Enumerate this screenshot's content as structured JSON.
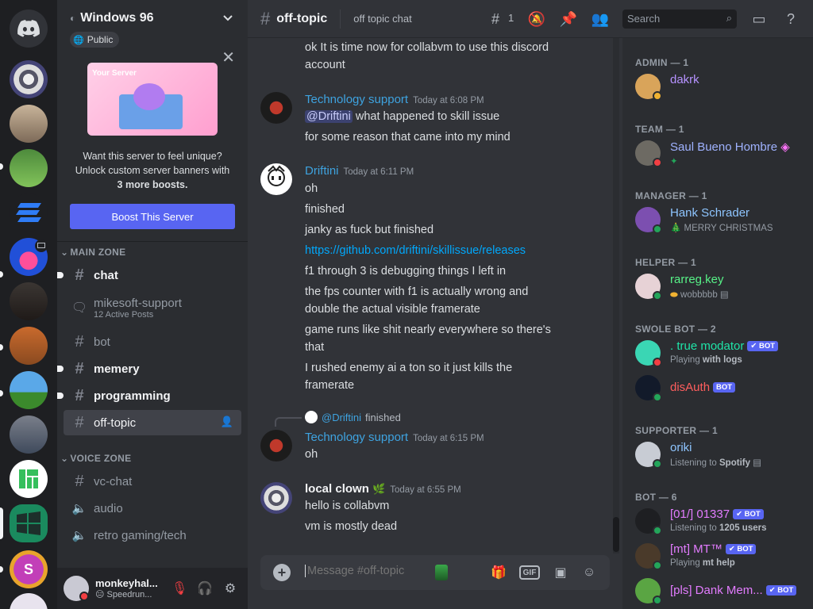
{
  "colors": {
    "accent": "#5865f2",
    "online": "#23a55a",
    "dnd": "#f23f43",
    "link": "#00a8fc"
  },
  "server": {
    "name": "Windows 96",
    "public_label": "Public"
  },
  "boost": {
    "card_title": "Your Server",
    "line1": "Want this server to feel unique?",
    "line2": "Unlock custom server banners with",
    "line3": "3 more boosts.",
    "button": "Boost This Server"
  },
  "categories": {
    "main": "MAIN ZONE",
    "voice": "VOICE ZONE"
  },
  "channels": {
    "chat": "chat",
    "mikesoft_support": "mikesoft-support",
    "mikesoft_sub": "12 Active Posts",
    "bot": "bot",
    "memery": "memery",
    "programming": "programming",
    "off_topic": "off-topic",
    "vc_chat": "vc-chat",
    "audio": "audio",
    "retro": "retro gaming/tech"
  },
  "user": {
    "name": "monkeyhal...",
    "status": "Speedrun..."
  },
  "topbar": {
    "channel": "off-topic",
    "topic": "off topic chat",
    "threads_count": "1",
    "search_placeholder": "Search"
  },
  "messages": {
    "m0_l1": "ok It is time now for collabvm to use this discord",
    "m0_l2": "account",
    "m1_author": "Technology support",
    "m1_time": "Today at 6:08 PM",
    "m1_mention": "@Driftini",
    "m1_l1": " what happened to skill issue",
    "m1_l2": "for some reason that came into my mind",
    "m2_author": "Driftini",
    "m2_time": "Today at 6:11 PM",
    "m2_l1": "oh",
    "m2_l2": "finished",
    "m2_l3": "janky as fuck but finished",
    "m2_link": "https://github.com/driftini/skillissue/releases",
    "m2_l4": "f1 through 3 is debugging things I left in",
    "m2_l5a": "the fps counter with f1 is actually wrong and",
    "m2_l5b": "double the actual visible framerate",
    "m2_l6a": "game runs like shit nearly everywhere so there's",
    "m2_l6b": "that",
    "m2_l7a": "I rushed enemy ai a ton so it just kills the",
    "m2_l7b": "framerate",
    "reply_name": "@Driftini",
    "reply_text": "finished",
    "m3_author": "Technology support",
    "m3_time": "Today at 6:15 PM",
    "m3_l1": "oh",
    "m4_author": "local clown",
    "m4_time": "Today at 6:55 PM",
    "m4_l1": "hello is collabvm",
    "m4_l2": "vm is mostly dead"
  },
  "composer": {
    "placeholder": "Message #off-topic",
    "gif": "GIF"
  },
  "members": {
    "admin": "ADMIN — 1",
    "dakrk": "dakrk",
    "team": "TEAM — 1",
    "saul": "Saul Bueno Hombre",
    "manager": "MANAGER — 1",
    "hank": "Hank Schrader",
    "hank_status": "🎄 MERRY CHRISTMAS",
    "helper": "HELPER — 1",
    "rarreg": "rarreg.key",
    "rarreg_status": "wobbbbb",
    "swole": "SWOLE BOT — 2",
    "truemod": ". true modator",
    "truemod_prefix": "Playing ",
    "truemod_bold": "with logs",
    "disauth": "disAuth",
    "supporter": "SUPPORTER — 1",
    "oriki": "oriki",
    "oriki_prefix": "Listening to ",
    "oriki_bold": "Spotify",
    "botrole": "BOT — 6",
    "b1": "[01/] 01337",
    "b1_prefix": "Listening to ",
    "b1_bold": "1205 users",
    "b2": "[mt] MT™",
    "b2_prefix": "Playing ",
    "b2_bold": "mt help",
    "b3": "[pls] Dank Mem...",
    "bot_badge": "BOT",
    "bot_badge_v": "✔ BOT"
  }
}
